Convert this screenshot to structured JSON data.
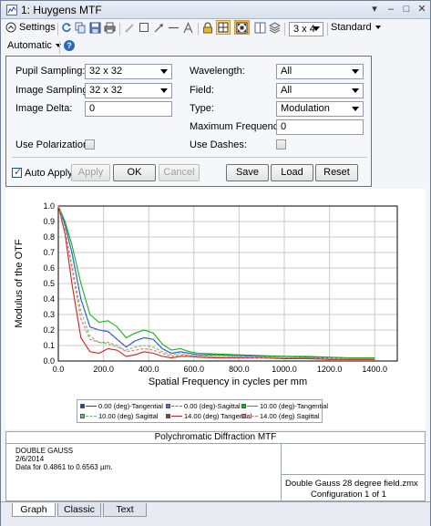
{
  "window": {
    "title": "1: Huygens MTF",
    "controls": [
      "▾",
      "–",
      "□",
      "✕"
    ]
  },
  "toolbar": {
    "settings_label": "Settings",
    "layout_value": "3 x 4",
    "style_value": "Standard",
    "automatic_label": "Automatic",
    "help_icon": "?"
  },
  "settings": {
    "pupil_sampling_label": "Pupil Sampling:",
    "pupil_sampling_value": "32 x 32",
    "image_sampling_label": "Image Sampling:",
    "image_sampling_value": "32 x 32",
    "image_delta_label": "Image Delta:",
    "image_delta_value": "0",
    "use_polarization_label": "Use Polarization:",
    "wavelength_label": "Wavelength:",
    "wavelength_value": "All",
    "field_label": "Field:",
    "field_value": "All",
    "type_label": "Type:",
    "type_value": "Modulation",
    "max_freq_label": "Maximum Frequency:",
    "max_freq_value": "0",
    "use_dashes_label": "Use Dashes:",
    "auto_apply_label": "Auto Apply",
    "apply_label": "Apply",
    "ok_label": "OK",
    "cancel_label": "Cancel",
    "save_label": "Save",
    "load_label": "Load",
    "reset_label": "Reset"
  },
  "chart_data": {
    "type": "line",
    "title": "",
    "xlabel": "Spatial Frequency in cycles per mm",
    "ylabel": "Modulus of the OTF",
    "xlim": [
      0,
      1500
    ],
    "ylim": [
      0,
      1.0
    ],
    "xticks": [
      "0.0",
      "200.0",
      "400.0",
      "600.0",
      "800.0",
      "1000.0",
      "1200.0",
      "1400.0"
    ],
    "yticks": [
      "0.0",
      "0.1",
      "0.2",
      "0.3",
      "0.4",
      "0.5",
      "0.6",
      "0.7",
      "0.8",
      "0.9",
      "1.0"
    ],
    "grid": true,
    "series": [
      {
        "name": "0.00 (deg)-Tangential",
        "color": "#1e3cc8",
        "dash": false,
        "x": [
          0,
          30,
          60,
          100,
          140,
          180,
          220,
          260,
          300,
          340,
          380,
          420,
          460,
          500,
          540,
          580,
          620,
          700,
          800,
          900,
          1000,
          1100,
          1200,
          1300,
          1400
        ],
        "y": [
          1.0,
          0.88,
          0.7,
          0.4,
          0.22,
          0.2,
          0.19,
          0.14,
          0.09,
          0.13,
          0.15,
          0.14,
          0.08,
          0.05,
          0.06,
          0.05,
          0.04,
          0.04,
          0.035,
          0.03,
          0.03,
          0.025,
          0.02,
          0.02,
          0.02
        ]
      },
      {
        "name": "0.00 (deg)-Sagittal",
        "color": "#4678d2",
        "dash": true,
        "x": [
          0,
          30,
          60,
          100,
          140,
          180,
          220,
          260,
          300,
          340,
          380,
          420,
          460,
          500,
          540,
          580,
          620,
          700,
          800,
          900,
          1000,
          1100,
          1200,
          1300,
          1400
        ],
        "y": [
          1.0,
          0.88,
          0.7,
          0.4,
          0.22,
          0.2,
          0.19,
          0.14,
          0.09,
          0.13,
          0.15,
          0.14,
          0.08,
          0.05,
          0.06,
          0.05,
          0.04,
          0.04,
          0.035,
          0.03,
          0.03,
          0.025,
          0.02,
          0.02,
          0.02
        ]
      },
      {
        "name": "10.00 (deg)-Tangential",
        "color": "#14b414",
        "dash": false,
        "x": [
          0,
          30,
          60,
          100,
          140,
          180,
          220,
          260,
          300,
          340,
          380,
          420,
          460,
          500,
          540,
          580,
          620,
          700,
          800,
          900,
          1000,
          1100,
          1200,
          1300,
          1400
        ],
        "y": [
          1.0,
          0.9,
          0.75,
          0.5,
          0.3,
          0.25,
          0.26,
          0.22,
          0.15,
          0.18,
          0.2,
          0.18,
          0.11,
          0.07,
          0.08,
          0.06,
          0.05,
          0.045,
          0.04,
          0.035,
          0.03,
          0.03,
          0.025,
          0.02,
          0.02
        ]
      },
      {
        "name": "10.00 (deg) Sagittal",
        "color": "#64c864",
        "dash": true,
        "x": [
          0,
          30,
          60,
          100,
          140,
          180,
          220,
          260,
          300,
          340,
          380,
          420,
          460,
          500,
          540,
          580,
          620,
          700,
          800,
          900,
          1000,
          1100,
          1200,
          1300,
          1400
        ],
        "y": [
          1.0,
          0.85,
          0.62,
          0.32,
          0.16,
          0.12,
          0.11,
          0.09,
          0.07,
          0.09,
          0.1,
          0.09,
          0.06,
          0.04,
          0.05,
          0.04,
          0.035,
          0.03,
          0.03,
          0.025,
          0.025,
          0.02,
          0.02,
          0.015,
          0.015
        ]
      },
      {
        "name": "14.00 (deg) Tangential",
        "color": "#d21e1e",
        "dash": false,
        "x": [
          0,
          30,
          60,
          100,
          140,
          180,
          220,
          260,
          300,
          340,
          380,
          420,
          460,
          500,
          540,
          580,
          620,
          700,
          800,
          900,
          1000,
          1100,
          1200,
          1300,
          1400
        ],
        "y": [
          1.0,
          0.82,
          0.5,
          0.15,
          0.06,
          0.05,
          0.08,
          0.07,
          0.03,
          0.04,
          0.06,
          0.05,
          0.03,
          0.02,
          0.03,
          0.03,
          0.025,
          0.02,
          0.02,
          0.02,
          0.015,
          0.015,
          0.01,
          0.01,
          0.01
        ]
      },
      {
        "name": "14.00 (deg) Sagittal",
        "color": "#e66e6e",
        "dash": true,
        "x": [
          0,
          30,
          60,
          100,
          140,
          180,
          220,
          260,
          300,
          340,
          380,
          420,
          460,
          500,
          540,
          580,
          620,
          700,
          800,
          900,
          1000,
          1100,
          1200,
          1300,
          1400
        ],
        "y": [
          1.0,
          0.84,
          0.6,
          0.27,
          0.14,
          0.12,
          0.12,
          0.1,
          0.06,
          0.07,
          0.08,
          0.07,
          0.05,
          0.03,
          0.04,
          0.035,
          0.03,
          0.025,
          0.025,
          0.02,
          0.02,
          0.02,
          0.015,
          0.015,
          0.015
        ]
      }
    ]
  },
  "legend": {
    "items": [
      "0.00 (deg)-Tangential",
      "0.00 (deg)-Sagittal",
      "10.00 (deg)-Tangential",
      "10.00 (deg) Sagittal",
      "14.00 (deg) Tangential",
      "14.00 (deg) Sagittal"
    ]
  },
  "info": {
    "header": "Polychromatic Diffraction MTF",
    "line1": "DOUBLE GAUSS",
    "line2": "2/6/2014",
    "line3": "Data for 0.4861 to 0.6563 µm.",
    "file": "Double Gauss 28 degree field.zmx",
    "config": "Configuration 1 of 1"
  },
  "tabs": [
    "Graph",
    "Classic",
    "Text"
  ]
}
